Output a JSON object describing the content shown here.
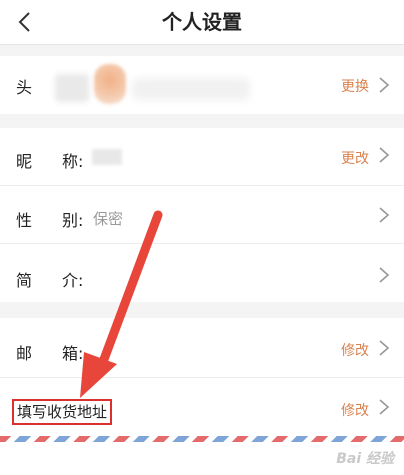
{
  "header": {
    "title": "个人设置",
    "back_icon": "chevron-left-icon"
  },
  "avatar_row": {
    "label": "头",
    "action": "更换"
  },
  "nickname_row": {
    "label_a": "昵",
    "label_b": "称:",
    "action": "更改"
  },
  "gender_row": {
    "label_a": "性",
    "label_b": "别:",
    "value": "保密"
  },
  "intro_row": {
    "label_a": "简",
    "label_b": "介:"
  },
  "email_row": {
    "label_a": "邮",
    "label_b": "箱:",
    "action": "修改"
  },
  "address_row": {
    "label": "填写收货地址",
    "action": "修改"
  },
  "annotation": {
    "arrow_color": "#e8463a",
    "highlight_color": "#d93030"
  },
  "colors": {
    "action_text": "#d9824f",
    "background": "#f4f4f4"
  }
}
